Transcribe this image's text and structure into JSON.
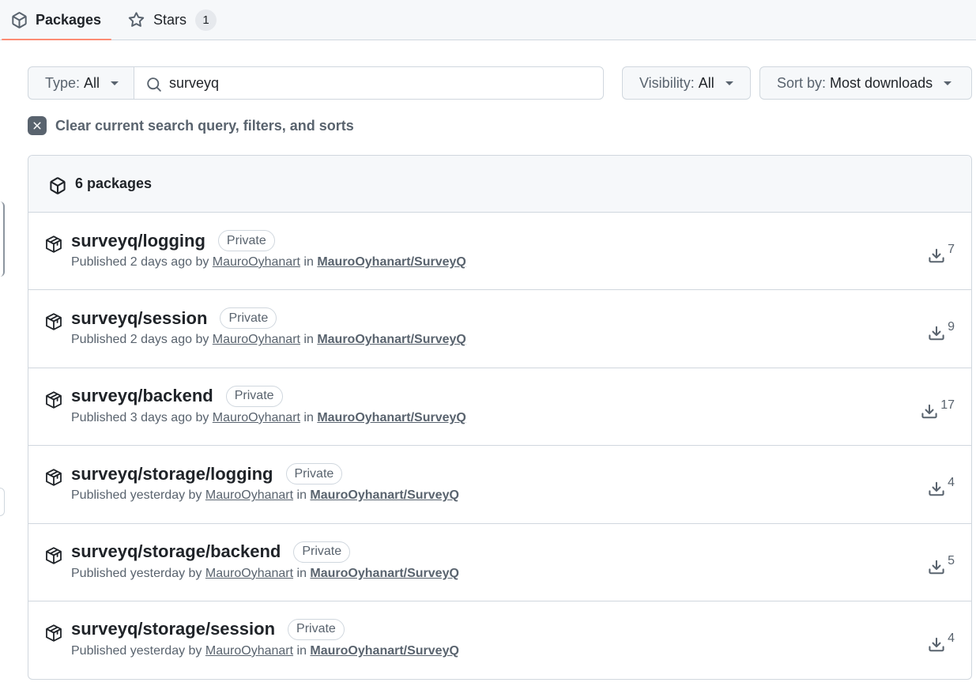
{
  "tabs": {
    "packages": {
      "label": "Packages",
      "icon": "package-icon"
    },
    "stars": {
      "label": "Stars",
      "count": "1",
      "icon": "star-icon"
    }
  },
  "filters": {
    "type": {
      "label": "Type:",
      "value": "All"
    },
    "search": {
      "value": "surveyq",
      "icon": "search-icon"
    },
    "visibility": {
      "label": "Visibility:",
      "value": "All"
    },
    "sort": {
      "label": "Sort by:",
      "value": "Most downloads"
    }
  },
  "clear_label": "Clear current search query, filters, and sorts",
  "list": {
    "count_label": "6 packages",
    "packages": [
      {
        "name": "surveyq/logging",
        "badge": "Private",
        "published_prefix": "Published 2 days ago by",
        "author": "MauroOyhanart",
        "in_word": "in",
        "repo": "MauroOyhanart/SurveyQ",
        "downloads": "7"
      },
      {
        "name": "surveyq/session",
        "badge": "Private",
        "published_prefix": "Published 2 days ago by",
        "author": "MauroOyhanart",
        "in_word": "in",
        "repo": "MauroOyhanart/SurveyQ",
        "downloads": "9"
      },
      {
        "name": "surveyq/backend",
        "badge": "Private",
        "published_prefix": "Published 3 days ago by",
        "author": "MauroOyhanart",
        "in_word": "in",
        "repo": "MauroOyhanart/SurveyQ",
        "downloads": "17"
      },
      {
        "name": "surveyq/storage/logging",
        "badge": "Private",
        "published_prefix": "Published yesterday by",
        "author": "MauroOyhanart",
        "in_word": "in",
        "repo": "MauroOyhanart/SurveyQ",
        "downloads": "4"
      },
      {
        "name": "surveyq/storage/backend",
        "badge": "Private",
        "published_prefix": "Published yesterday by",
        "author": "MauroOyhanart",
        "in_word": "in",
        "repo": "MauroOyhanart/SurveyQ",
        "downloads": "5"
      },
      {
        "name": "surveyq/storage/session",
        "badge": "Private",
        "published_prefix": "Published yesterday by",
        "author": "MauroOyhanart",
        "in_word": "in",
        "repo": "MauroOyhanart/SurveyQ",
        "downloads": "4"
      }
    ]
  },
  "colors": {
    "accent_underline": "#fd8c73",
    "border": "#d0d7de",
    "muted_text": "#59636e",
    "header_bg": "#f6f8fa"
  }
}
